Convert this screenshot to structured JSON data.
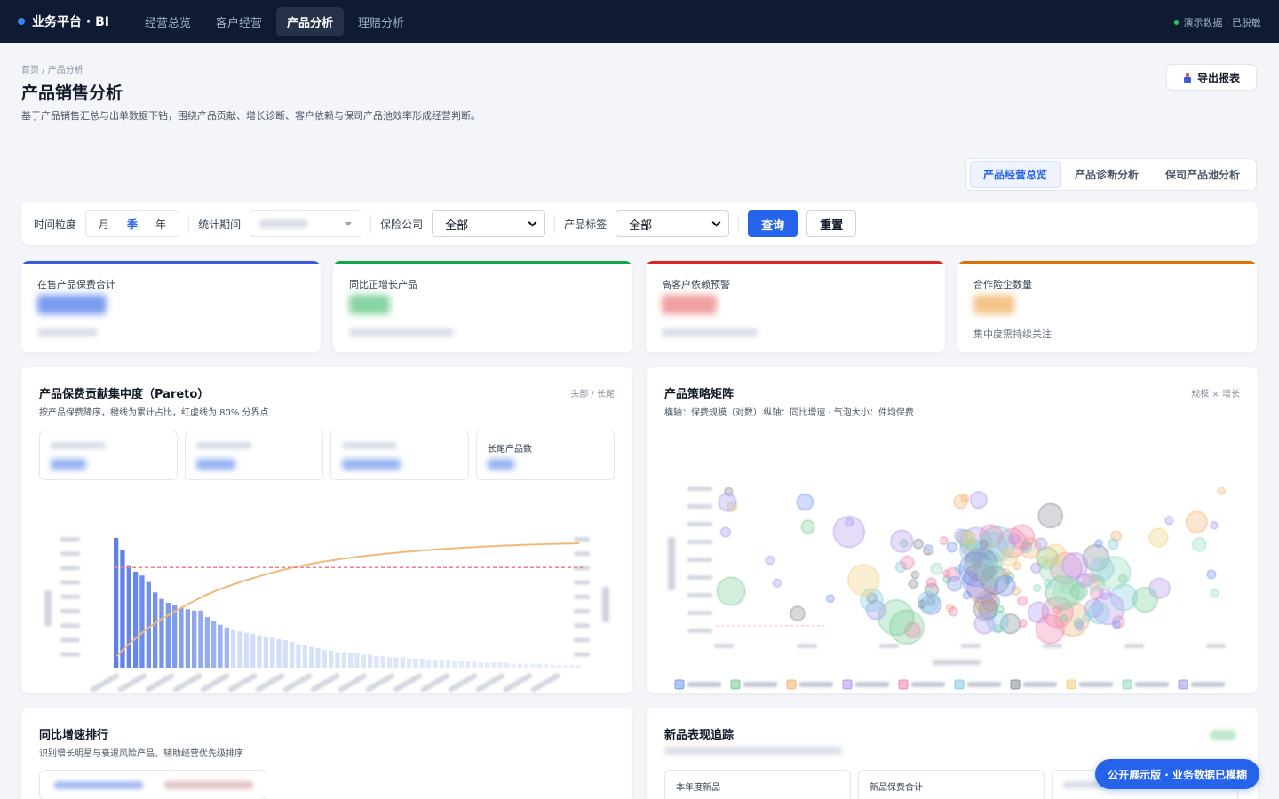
{
  "app": {
    "brand": "业务平台 · BI",
    "demo_flag": "演示数据 · 已脱敏"
  },
  "nav": {
    "items": [
      {
        "label": "经营总览"
      },
      {
        "label": "客户经营"
      },
      {
        "label": "产品分析",
        "active": true
      },
      {
        "label": "理赔分析"
      }
    ]
  },
  "page": {
    "breadcrumb": "首页 / 产品分析",
    "title": "产品销售分析",
    "description": "基于产品销售汇总与出单数据下钻，围绕产品贡献、增长诊断、客户依赖与保司产品池效率形成经营判断。",
    "export_label": "导出报表"
  },
  "view_tabs": [
    {
      "label": "产品经营总览",
      "active": true
    },
    {
      "label": "产品诊断分析"
    },
    {
      "label": "保司产品池分析"
    }
  ],
  "filters": {
    "granularity_label": "时间粒度",
    "granularity_options": [
      "月",
      "季",
      "年"
    ],
    "granularity_selected": "季",
    "period_label": "统计期间",
    "insurer_label": "保险公司",
    "insurer_value": "全部",
    "tag_label": "产品标签",
    "tag_value": "全部",
    "query_label": "查询",
    "reset_label": "重置"
  },
  "kpis": [
    {
      "label": "在售产品保费合计",
      "accent": "#3b5bdb",
      "value_color": "#7b9cf0"
    },
    {
      "label": "同比正增长产品",
      "accent": "#16a34a",
      "value_color": "#86d5a0"
    },
    {
      "label": "高客户依赖预警",
      "accent": "#dc2626",
      "value_color": "#f0a0a0"
    },
    {
      "label": "合作险企数量",
      "accent": "#d97706",
      "value_color": "#f3c58a",
      "subtext": "集中度需持续关注"
    }
  ],
  "pareto": {
    "title": "产品保费贡献集中度（Pareto）",
    "subtitle": "按产品保费降序，橙线为累计占比，红虚线为 80% 分界点",
    "tag": "头部 / 长尾",
    "mini_cards": [
      {
        "label": ""
      },
      {
        "label": ""
      },
      {
        "label": ""
      },
      {
        "label": "长尾产品数"
      }
    ]
  },
  "matrix": {
    "title": "产品策略矩阵",
    "subtitle": "横轴：保费规模（对数）· 纵轴：同比增速 · 气泡大小：件均保费",
    "tag": "规模 × 增长"
  },
  "growth": {
    "title": "同比增速排行",
    "subtitle": "识别增长明星与衰退风险产品，辅助经营优先级排序"
  },
  "newprod": {
    "title": "新品表现追踪",
    "mini_cards": [
      {
        "label": "本年度新品"
      },
      {
        "label": "新品保费合计"
      }
    ]
  },
  "badge": "公开展示版 · 业务数据已模糊",
  "colors": {
    "primary": "#2563eb",
    "topbar": "#0f1b33",
    "pareto_line": "#f0b97a",
    "threshold": "#f08080"
  },
  "chart_data": [
    {
      "type": "bar",
      "title": "产品保费贡献集中度（Pareto）",
      "values": [
        100,
        91,
        79,
        74,
        71,
        66,
        58,
        53,
        50,
        48,
        46,
        45,
        44,
        44,
        39,
        36,
        33,
        31,
        29,
        28,
        27,
        26,
        25,
        24,
        23,
        22,
        21,
        20,
        18,
        17,
        16,
        15,
        14,
        13,
        12,
        12,
        11,
        11,
        10,
        10,
        9,
        9,
        8,
        8,
        8,
        7,
        7,
        7,
        6,
        6,
        6,
        6,
        5,
        5,
        5,
        5,
        4,
        4,
        4,
        4,
        4,
        3,
        3,
        3,
        3,
        3,
        3,
        2,
        2,
        2,
        2,
        2
      ],
      "cumulative_share": true,
      "threshold": 0.8,
      "legend": "none"
    },
    {
      "type": "scatter",
      "title": "产品策略矩阵",
      "series_count": 10,
      "series_colors": [
        "#7b9cf0",
        "#7fcf9a",
        "#f2b77a",
        "#b59af0",
        "#f08ab3",
        "#86cfe0",
        "#8c939e",
        "#f2d27e",
        "#9adcc1",
        "#a89cf2"
      ],
      "legend": "bottom"
    }
  ]
}
